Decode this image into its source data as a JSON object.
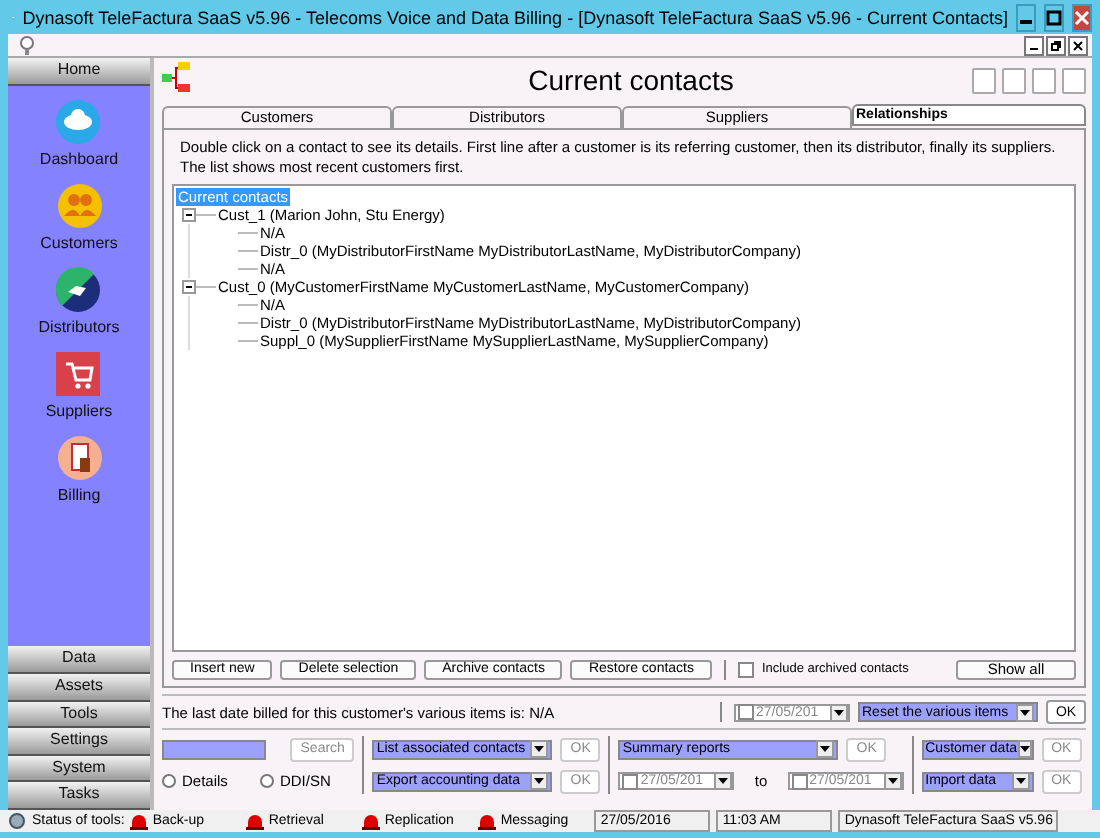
{
  "window": {
    "title": "Dynasoft TeleFactura SaaS v5.96 - Telecoms Voice and Data Billing - [Dynasoft TeleFactura SaaS v5.96 - Current Contacts]"
  },
  "sidebar": {
    "header": "Home",
    "items": [
      {
        "label": "Dashboard",
        "kind": "dashboard"
      },
      {
        "label": "Customers",
        "kind": "customers"
      },
      {
        "label": "Distributors",
        "kind": "distributors"
      },
      {
        "label": "Suppliers",
        "kind": "suppliers"
      },
      {
        "label": "Billing",
        "kind": "billing"
      }
    ],
    "sections": [
      "Data",
      "Assets",
      "Tools",
      "Settings",
      "System",
      "Tasks"
    ]
  },
  "page": {
    "title": "Current contacts"
  },
  "tabs": [
    {
      "label": "Customers",
      "selected": false
    },
    {
      "label": "Distributors",
      "selected": false
    },
    {
      "label": "Suppliers",
      "selected": false
    },
    {
      "label": "Relationships",
      "selected": true
    }
  ],
  "description": "Double click on a contact to see its details. First line after a customer is its referring customer, then its distributor, finally its suppliers. The list shows most recent customers first.",
  "tree": {
    "label": "Current contacts",
    "selected": true,
    "expanded": true,
    "children": [
      {
        "label": "Cust_1 (Marion John, Stu Energy)",
        "expanded": true,
        "children": [
          {
            "label": "N/A"
          },
          {
            "label": "Distr_0 (MyDistributorFirstName MyDistributorLastName, MyDistributorCompany)"
          },
          {
            "label": "N/A"
          }
        ]
      },
      {
        "label": "Cust_0 (MyCustomerFirstName MyCustomerLastName, MyCustomerCompany)",
        "expanded": true,
        "children": [
          {
            "label": "N/A"
          },
          {
            "label": "Distr_0 (MyDistributorFirstName MyDistributorLastName, MyDistributorCompany)"
          },
          {
            "label": "Suppl_0 (MySupplierFirstName MySupplierLastName, MySupplierCompany)"
          }
        ]
      }
    ]
  },
  "actions": [
    "Insert new",
    "Delete selection",
    "Archive contacts",
    "Restore contacts"
  ],
  "include_archived": {
    "label": "Include archived contacts",
    "checked": false
  },
  "show_all": "Show all",
  "last_billed": {
    "text": "The last date billed for this customer's various items is: N/A",
    "date": "27/05/201",
    "date_checked": false,
    "action": "Reset the various items",
    "ok": "OK"
  },
  "search": {
    "button": "Search",
    "button_disabled": true
  },
  "radios": [
    {
      "label": "Details",
      "selected": false
    },
    {
      "label": "DDI/SN",
      "selected": false
    }
  ],
  "tools": [
    {
      "select": "List associated contacts",
      "ok": "OK",
      "ok_disabled": true
    },
    {
      "select": "Export accounting data",
      "ok": "OK",
      "ok_disabled": true
    }
  ],
  "reports": {
    "select": "Summary reports",
    "ok": "OK",
    "ok_disabled": true,
    "from": "27/05/201",
    "from_checked": false,
    "to_label": "to",
    "to": "27/05/201",
    "to_checked": false
  },
  "data_tools": [
    {
      "select": "Customer data",
      "ok": "OK",
      "ok_disabled": true
    },
    {
      "select": "Import data",
      "ok": "OK",
      "ok_disabled": true
    }
  ],
  "status_bar": {
    "label": "Status of tools:",
    "tools": [
      "Back-up",
      "Retrieval",
      "Replication",
      "Messaging"
    ],
    "date": "27/05/2016",
    "time": "11:03 AM",
    "product": "Dynasoft TeleFactura SaaS v5.96"
  }
}
